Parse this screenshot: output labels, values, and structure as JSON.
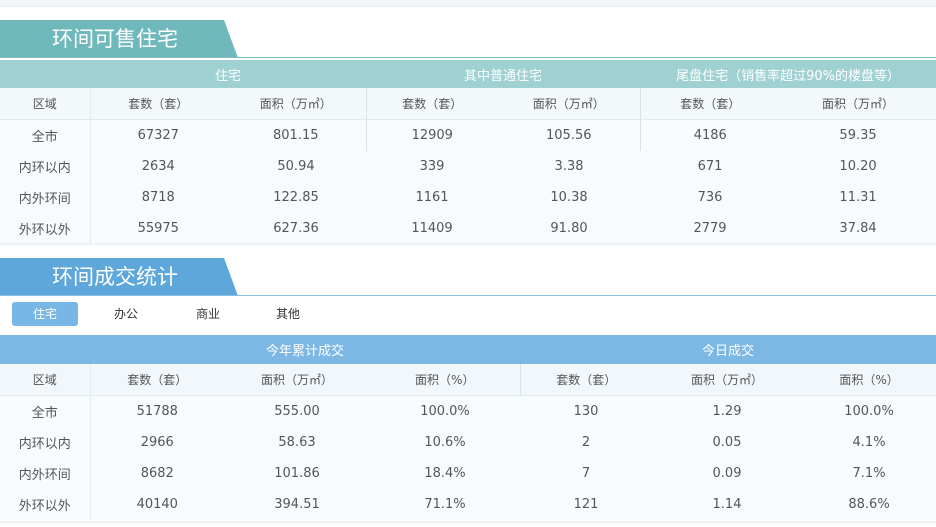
{
  "section1": {
    "title": "环间可售住宅",
    "groups": [
      "住宅",
      "其中普通住宅",
      "尾盘住宅（销售率超过90%的楼盘等）"
    ],
    "columns": [
      "区域",
      "套数（套）",
      "面积（万㎡）",
      "套数（套）",
      "面积（万㎡）",
      "套数（套）",
      "面积（万㎡）"
    ],
    "rows": [
      [
        "全市",
        "67327",
        "801.15",
        "12909",
        "105.56",
        "4186",
        "59.35"
      ],
      [
        "内环以内",
        "2634",
        "50.94",
        "339",
        "3.38",
        "671",
        "10.20"
      ],
      [
        "内外环间",
        "8718",
        "122.85",
        "1161",
        "10.38",
        "736",
        "11.31"
      ],
      [
        "外环以外",
        "55975",
        "627.36",
        "11409",
        "91.80",
        "2779",
        "37.84"
      ]
    ]
  },
  "section2": {
    "title": "环间成交统计",
    "tabs": [
      "住宅",
      "办公",
      "商业",
      "其他"
    ],
    "active_tab": "住宅",
    "groups": [
      "今年累计成交",
      "今日成交"
    ],
    "columns": [
      "区域",
      "套数（套）",
      "面积（万㎡）",
      "面积（%）",
      "套数（套）",
      "面积（万㎡）",
      "面积（%）"
    ],
    "rows": [
      [
        "全市",
        "51788",
        "555.00",
        "100.0%",
        "130",
        "1.29",
        "100.0%"
      ],
      [
        "内环以内",
        "2966",
        "58.63",
        "10.6%",
        "2",
        "0.05",
        "4.1%"
      ],
      [
        "内外环间",
        "8682",
        "101.86",
        "18.4%",
        "7",
        "0.09",
        "7.1%"
      ],
      [
        "外环以外",
        "40140",
        "394.51",
        "71.1%",
        "121",
        "1.14",
        "88.6%"
      ]
    ]
  },
  "colors": {
    "section1_accent": "#6fb8bb",
    "section1_header": "#9fd1d2",
    "section2_accent": "#5da7da",
    "section2_header": "#7db8e5",
    "active_tab": "#78b6e6"
  }
}
